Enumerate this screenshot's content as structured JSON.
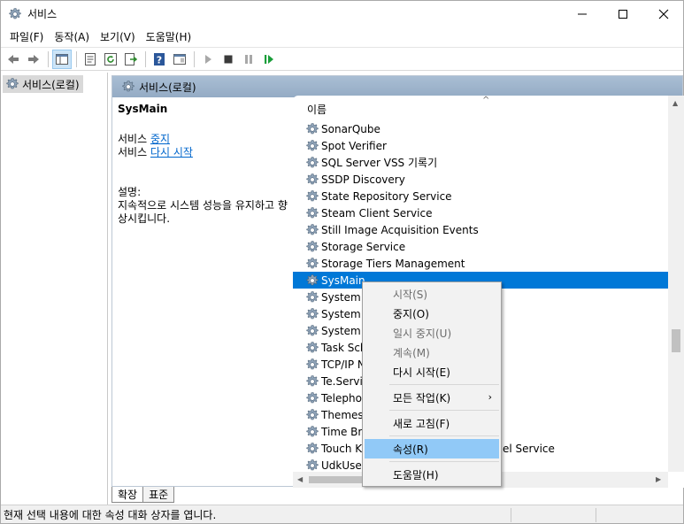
{
  "window": {
    "title": "서비스"
  },
  "menubar": [
    "파일(F)",
    "동작(A)",
    "보기(V)",
    "도움말(H)"
  ],
  "toolbar": [
    "back-icon",
    "forward-icon",
    "console-tree-icon",
    "properties-icon",
    "refresh-icon",
    "export-icon",
    "help-icon",
    "show-hide-icon",
    "start-icon",
    "stop-icon",
    "pause-icon",
    "restart-icon"
  ],
  "tree": {
    "root": "서비스(로컬)"
  },
  "main": {
    "header": "서비스(로컬)",
    "selected_name": "SysMain",
    "action_prefix_1": "서비스 ",
    "action_link_1": "중지",
    "action_prefix_2": "서비스 ",
    "action_link_2": "다시 시작",
    "desc_label": "설명:",
    "desc_text": "지속적으로 시스템 성능을 유지하고 향상시킵니다."
  },
  "list": {
    "column": "이름",
    "rows": [
      "SonarQube",
      "Spot Verifier",
      "SQL Server VSS 기록기",
      "SSDP Discovery",
      "State Repository Service",
      "Steam Client Service",
      "Still Image Acquisition Events",
      "Storage Service",
      "Storage Tiers Management",
      "SysMain",
      "System E",
      "System E",
      "System G",
      "Task Sch",
      "TCP/IP N",
      "Te.Servic",
      "Telephon",
      "Themes",
      "Time Bro",
      "Touch Ke",
      "UdkUserS"
    ],
    "row_tail": "el Service",
    "selected_index": 9
  },
  "context_menu": {
    "items": [
      {
        "label": "시작(S)",
        "disabled": true
      },
      {
        "label": "중지(O)",
        "disabled": false
      },
      {
        "label": "일시 중지(U)",
        "disabled": true
      },
      {
        "label": "계속(M)",
        "disabled": true
      },
      {
        "label": "다시 시작(E)",
        "disabled": false
      },
      {
        "label": "모든 작업(K)",
        "disabled": false,
        "submenu": true
      },
      {
        "label": "새로 고침(F)",
        "disabled": false
      },
      {
        "label": "속성(R)",
        "disabled": false,
        "highlighted": true
      },
      {
        "label": "도움말(H)",
        "disabled": false
      }
    ]
  },
  "tabs": [
    "확장",
    "표준"
  ],
  "status": "현재 선택 내용에 대한 속성 대화 상자를 엽니다.",
  "colors": {
    "selection": "#0078d7",
    "menu_highlight": "#91c9f7",
    "header": "#a9bed4",
    "link": "#0066cc"
  }
}
